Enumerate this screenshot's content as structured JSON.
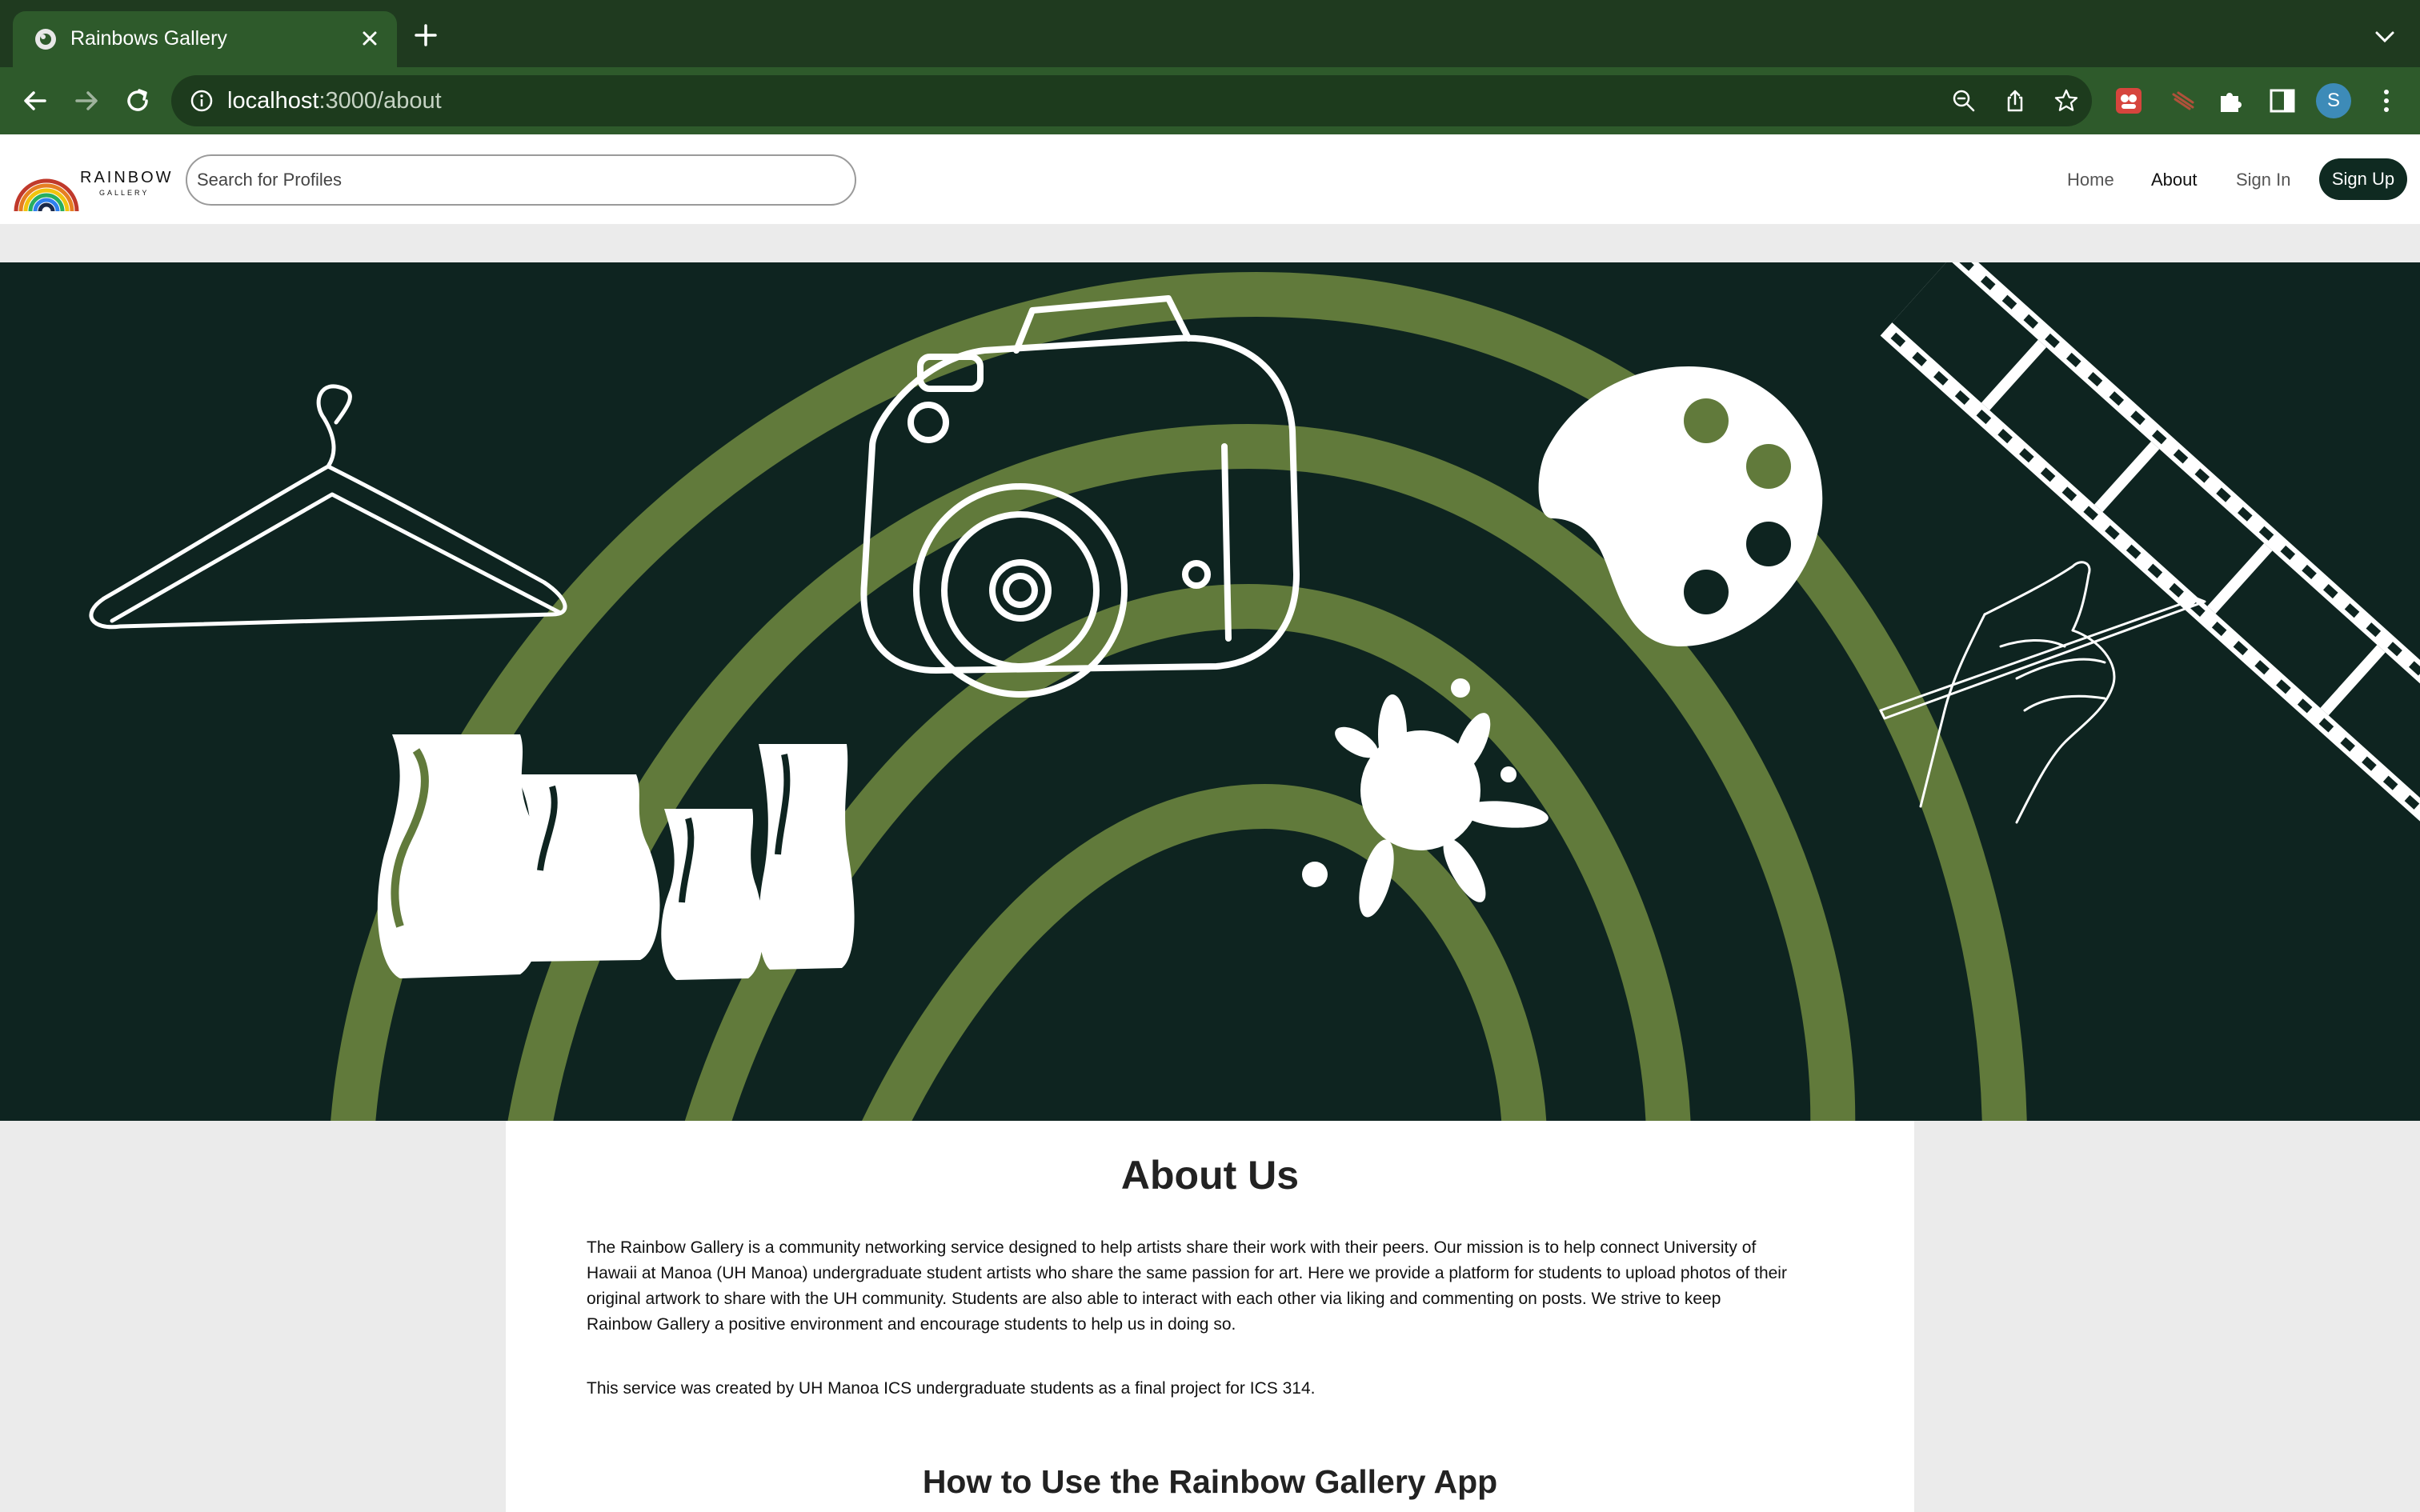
{
  "browser": {
    "tab_title": "Rainbows Gallery",
    "url_host": "localhost",
    "url_path": ":3000/about",
    "profile_initial": "S",
    "theme_color": "#2e5a2b",
    "icons": [
      "back-arrow-icon",
      "forward-arrow-icon",
      "reload-icon",
      "info-icon",
      "zoom-out-icon",
      "share-icon",
      "star-icon",
      "extensions-icon",
      "side-panel-icon",
      "more-vert-icon",
      "close-icon",
      "plus-icon",
      "chevron-down-icon"
    ]
  },
  "navbar": {
    "logo_text": "RAINBOW",
    "logo_subtext": "GALLERY",
    "search_placeholder": "Search for Profiles",
    "links": [
      {
        "label": "Home",
        "active": false
      },
      {
        "label": "About",
        "active": true
      },
      {
        "label": "Sign In",
        "active": false
      }
    ],
    "signup_label": "Sign Up",
    "accent_color": "#0f2a21"
  },
  "hero": {
    "background_color": "#0e2420",
    "arc_color": "#617a3b",
    "illustrations": [
      "hanger",
      "camera",
      "paint-palette",
      "film-strip",
      "pottery-vases",
      "paint-splash",
      "hand-with-pencil"
    ]
  },
  "about": {
    "title": "About Us",
    "paragraph_1_lines": [
      "The Rainbow Gallery is a community networking service designed to help artists share their work with their peers. Our mission is to help connect University of",
      "Hawaii at Manoa (UH Manoa) undergraduate student artists who share the same passion for art. Here we provide a platform for students to upload photos of their",
      "original artwork to share with the UH community. Students are also able to interact with each other via liking and commenting on posts. We strive to keep",
      "Rainbow Gallery a positive environment and encourage students to help us in doing so."
    ],
    "paragraph_2": "This service was created by UH Manoa ICS undergraduate students as a final project for ICS 314.",
    "how_to_title": "How to Use the Rainbow Gallery App"
  }
}
